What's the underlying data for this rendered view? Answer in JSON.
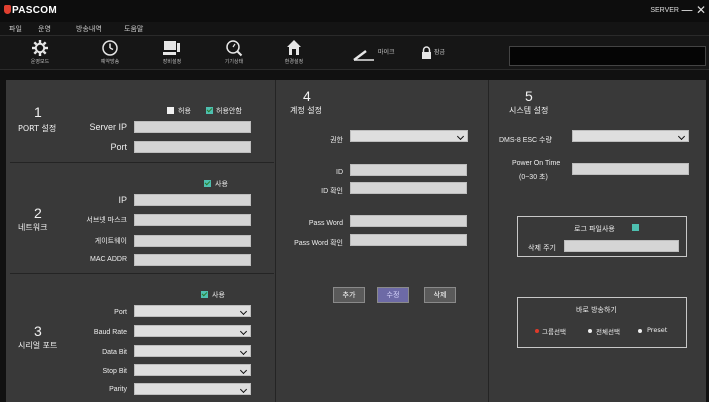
{
  "app": {
    "logo": "PASCOM",
    "server_label": "SERVER",
    "minimize": "—",
    "close": "✕"
  },
  "menu": [
    "파일",
    "운영",
    "방송내역",
    "도움말"
  ],
  "toolbar": {
    "items": [
      {
        "label": "운영모드",
        "icon": "gear-icon"
      },
      {
        "label": "예약방송",
        "icon": "clock-icon"
      },
      {
        "label": "장비설정",
        "icon": "device-icon"
      },
      {
        "label": "기기상태",
        "icon": "status-icon"
      },
      {
        "label": "환경설정",
        "icon": "house-icon"
      }
    ],
    "mic_label": "마이크",
    "lock_label": "잠금"
  },
  "port": {
    "num": "1",
    "title": "PORT 설정",
    "allow_label": "허용",
    "disallow_label": "허용안함",
    "allow_checked": false,
    "disallow_checked": true,
    "server_ip_label": "Server IP",
    "port_label": "Port"
  },
  "network": {
    "num": "2",
    "title": "네트워크",
    "use_label": "사용",
    "use_checked": true,
    "fields": [
      "IP",
      "서브넷 마스크",
      "게이트웨이",
      "MAC ADDR"
    ]
  },
  "serial": {
    "num": "3",
    "title": "시리얼 포트",
    "use_label": "사용",
    "use_checked": true,
    "fields": [
      "Port",
      "Baud Rate",
      "Data Bit",
      "Stop Bit",
      "Parity"
    ]
  },
  "account": {
    "num": "4",
    "title": "계정 설정",
    "authority_label": "권한",
    "id_label": "ID",
    "id_confirm_label": "ID 확인",
    "password_label": "Pass Word",
    "password_confirm_label": "Pass Word 확인",
    "add_button": "추가",
    "edit_button": "수정",
    "delete_button": "삭제"
  },
  "system": {
    "num": "5",
    "title": "시스템 설정",
    "dms_label": "DMS-8 ESC 수량",
    "power_on_label": "Power On Time",
    "power_on_range": "(0~30 초)",
    "log_label": "로그 파일사용",
    "log_checked": true,
    "delete_cycle_label": "삭제 주기",
    "broadcast_title": "바로 방송하기",
    "radios": [
      "그룹선택",
      "전체선택",
      "Preset"
    ],
    "radio_selected": "그룹선택"
  },
  "colors": {
    "panel": "#393939",
    "input": "#d5d5d5",
    "accent_radio": "#e03a2a",
    "checkbox_teal": "#4ec0b0",
    "active_button": "#6d6aa6"
  }
}
